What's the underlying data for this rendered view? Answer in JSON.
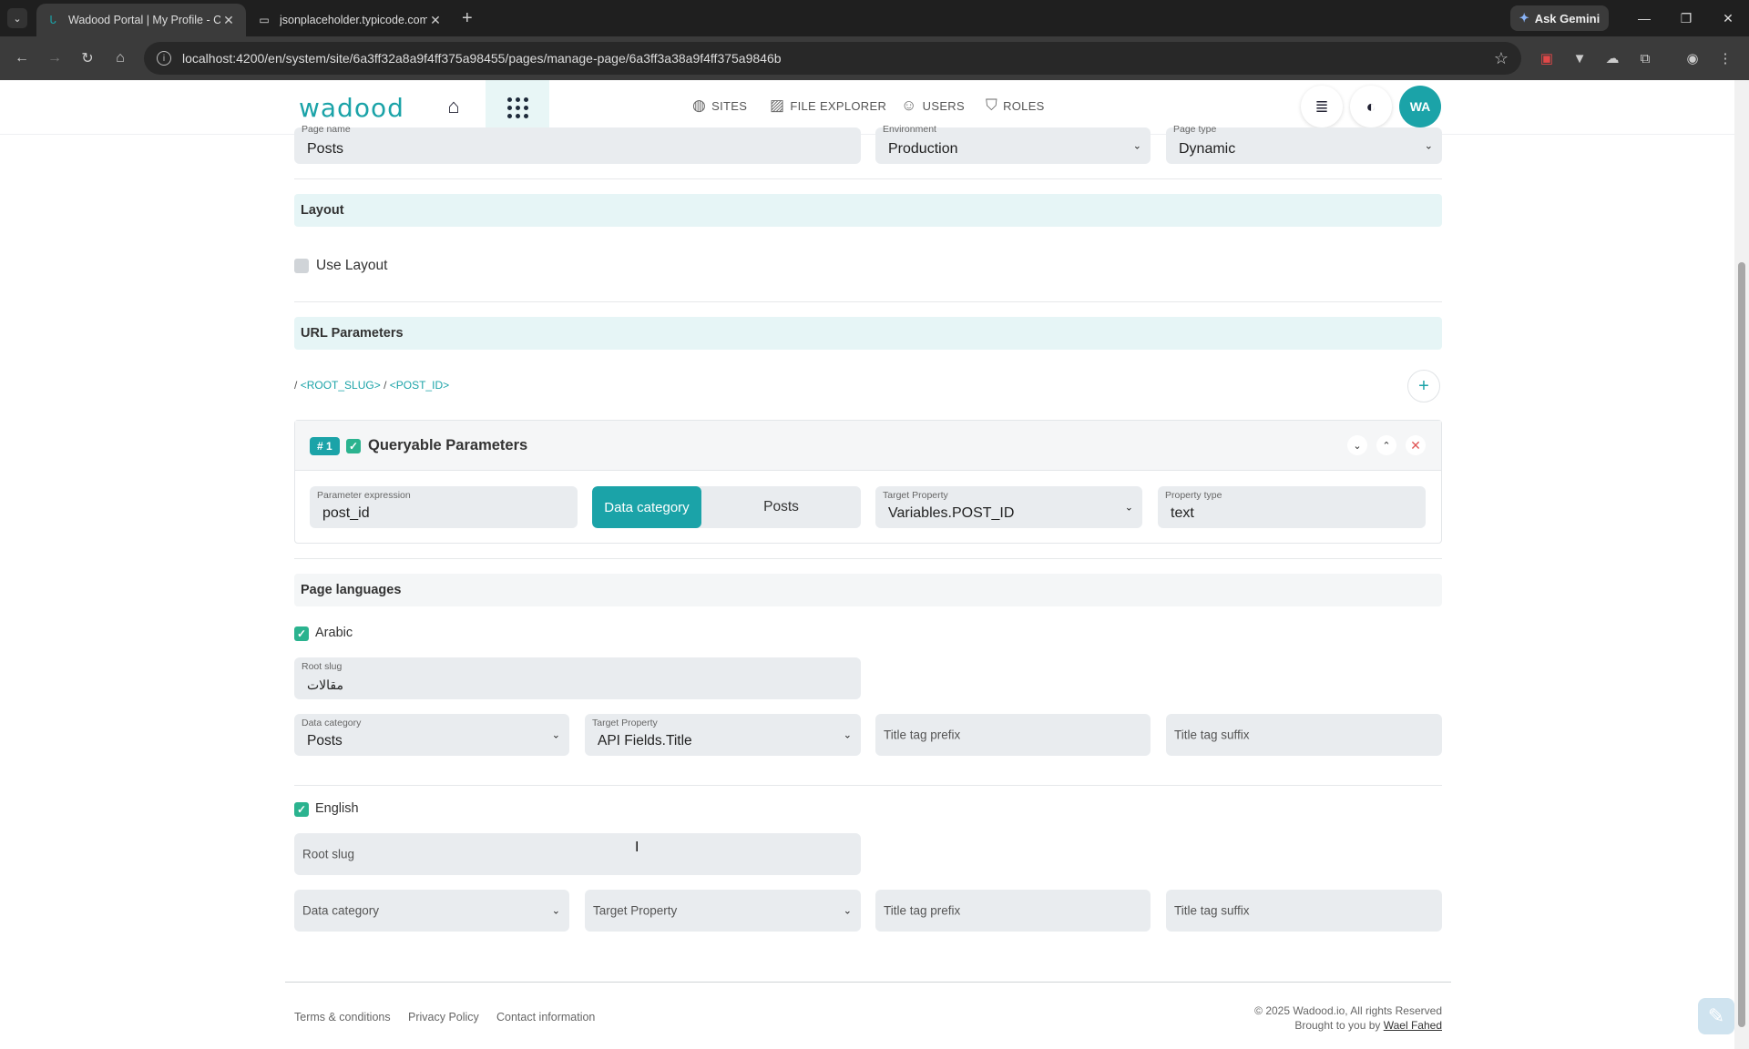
{
  "browser": {
    "tabs": [
      {
        "title": "Wadood Portal | My Profile - Cr",
        "active": true
      },
      {
        "title": "jsonplaceholder.typicode.com/",
        "active": false
      }
    ],
    "ask_gemini": "Ask Gemini",
    "url": "localhost:4200/en/system/site/6a3ff32a8a9f4ff375a98455/pages/manage-page/6a3ff3a38a9f4ff375a9846b"
  },
  "header": {
    "logo": "wadood",
    "nav": [
      {
        "label": "SITES",
        "icon": "globe-icon"
      },
      {
        "label": "FILE EXPLORER",
        "icon": "folder-image-icon"
      },
      {
        "label": "USERS",
        "icon": "users-icon"
      },
      {
        "label": "ROLES",
        "icon": "shield-icon"
      }
    ],
    "avatar": "WA"
  },
  "top_fields": {
    "page_name_label": "Page name",
    "page_name": "Posts",
    "environment_label": "Environment",
    "environment": "Production",
    "page_type_label": "Page type",
    "page_type": "Dynamic"
  },
  "layout": {
    "section_title": "Layout",
    "use_layout": "Use Layout",
    "use_layout_checked": false
  },
  "url_params": {
    "section_title": "URL Parameters",
    "path_sep": "/",
    "path_tokens": [
      "<ROOT_SLUG>",
      "<POST_ID>"
    ],
    "param": {
      "badge": "# 1",
      "title": "Queryable Parameters",
      "expression_label": "Parameter expression",
      "expression": "post_id",
      "toggle_on": "Data category",
      "toggle_off": "Posts",
      "target_label": "Target Property",
      "target": "Variables.POST_ID",
      "ptype_label": "Property type",
      "ptype": "text"
    }
  },
  "languages": {
    "section_title": "Page languages",
    "arabic": {
      "label": "Arabic",
      "root_slug_label": "Root slug",
      "root_slug": "مقالات",
      "data_category_label": "Data category",
      "data_category": "Posts",
      "target_label": "Target Property",
      "target": "API Fields.Title",
      "prefix_ph": "Title tag prefix",
      "suffix_ph": "Title tag suffix"
    },
    "english": {
      "label": "English",
      "root_slug_ph": "Root slug",
      "data_category_ph": "Data category",
      "target_ph": "Target Property",
      "prefix_ph": "Title tag prefix",
      "suffix_ph": "Title tag suffix"
    }
  },
  "footer": {
    "links": [
      "Terms & conditions",
      "Privacy Policy",
      "Contact information"
    ],
    "copyright": "© 2025 Wadood.io, All rights Reserved",
    "brought_by": "Brought to you by",
    "author": "Wael Fahed"
  },
  "colors": {
    "accent": "#1ba3a8",
    "check": "#2bb38f",
    "danger": "#e05555"
  }
}
